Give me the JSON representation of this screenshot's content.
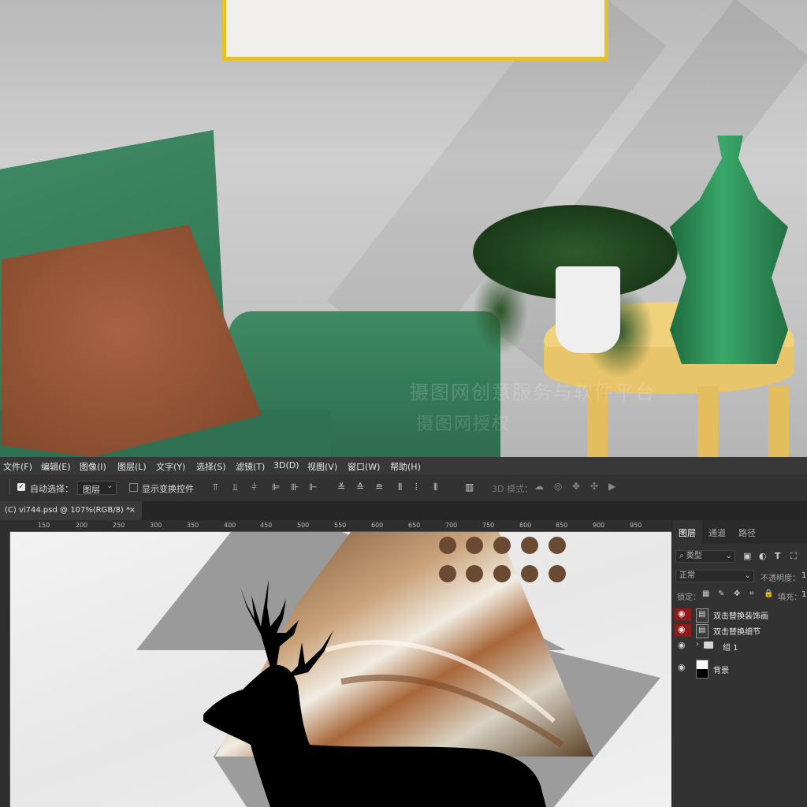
{
  "watermark": {
    "line1": "摄图网创意服务与软件平台",
    "line2": "摄图网授权"
  },
  "menubar": {
    "items": [
      "文件(F)",
      "编辑(E)",
      "图像(I)",
      "图层(L)",
      "文字(Y)",
      "选择(S)",
      "滤镜(T)",
      "3D(D)",
      "视图(V)",
      "窗口(W)",
      "帮助(H)"
    ]
  },
  "options": {
    "auto_select_label": "自动选择：",
    "auto_select_checked": true,
    "auto_select_target": "图层",
    "show_transform_label": "显示变换控件",
    "show_transform_checked": false,
    "mode_3d_label": "3D 模式："
  },
  "document_tab": {
    "title": "(C) vi744.psd @ 107%(RGB/8) *",
    "close": "×"
  },
  "ruler": {
    "h_ticks": [
      "150",
      "200",
      "250",
      "300",
      "350",
      "400",
      "450",
      "500",
      "550",
      "600",
      "650",
      "700",
      "750",
      "800",
      "850",
      "900",
      "950"
    ]
  },
  "panels": {
    "tabs": [
      "图层",
      "通道",
      "路径"
    ],
    "active_tab": "图层",
    "filter_kind": "类型",
    "blend_mode": "正常",
    "opacity_label": "不透明度：",
    "opacity_value": "1",
    "lock_label": "锁定：",
    "fill_label": "填充：",
    "fill_value": "1",
    "layers": [
      {
        "name": "双击替换装饰画",
        "visible": true,
        "type": "smart-object",
        "highlighted": true
      },
      {
        "name": "双击替换细节",
        "visible": true,
        "type": "smart-object",
        "highlighted": true
      },
      {
        "name": "组 1",
        "visible": true,
        "type": "group",
        "highlighted": false
      },
      {
        "name": "背景",
        "visible": true,
        "type": "background",
        "highlighted": false
      }
    ]
  },
  "colors": {
    "photoshop_bg": "#323232",
    "menubar_bg": "#383838",
    "layer_eye_highlight": "#8c1c1c",
    "dots_brown": "#6b4a33",
    "triangle_gray": "#9a9a9a",
    "frame_gold": "#e3c22a",
    "chair_green": "#3f8a64"
  }
}
